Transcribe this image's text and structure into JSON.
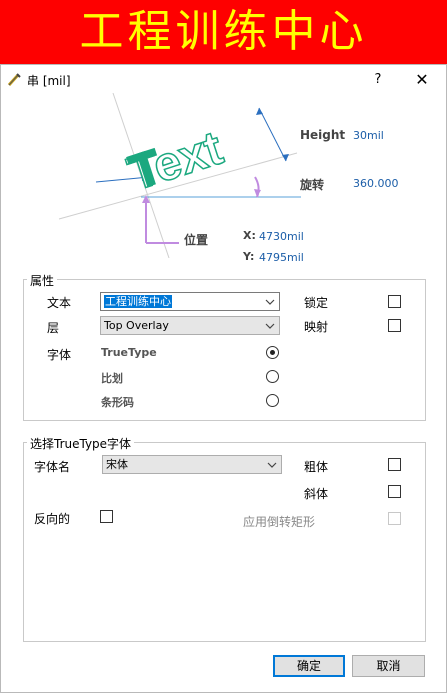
{
  "banner": {
    "text": "工程训练中心"
  },
  "window": {
    "title": "串 [mil]",
    "help_label": "?",
    "close_label": "✕"
  },
  "preview": {
    "sample_text": "Text",
    "height_label": "Height",
    "height_value": "30mil",
    "rotation_label": "旋转",
    "rotation_value": "360.000",
    "position_label": "位置",
    "x_label": "X:",
    "x_value": "4730mil",
    "y_label": "Y:",
    "y_value": "4795mil"
  },
  "properties": {
    "group_title": "属性",
    "text_label": "文本",
    "text_value": "工程训练中心",
    "layer_label": "层",
    "layer_value": "Top Overlay",
    "locked_label": "锁定",
    "mirror_label": "映射",
    "font_label": "字体",
    "font_options": [
      {
        "label": "TrueType",
        "selected": true
      },
      {
        "label": "比划",
        "selected": false
      },
      {
        "label": "条形码",
        "selected": false
      }
    ]
  },
  "truetype": {
    "group_title": "选择TrueType字体",
    "font_name_label": "字体名",
    "font_name_value": "宋体",
    "bold_label": "粗体",
    "italic_label": "斜体",
    "inverted_label": "反向的",
    "use_inverted_rect_label": "应用倒转矩形"
  },
  "buttons": {
    "ok_label": "确定",
    "cancel_label": "取消"
  },
  "colors": {
    "banner_bg": "#fe0000",
    "banner_text": "#ffff00",
    "text_sample": "#1ba87f",
    "accent_blue": "#1c5ea8",
    "selection": "#0078d7"
  }
}
